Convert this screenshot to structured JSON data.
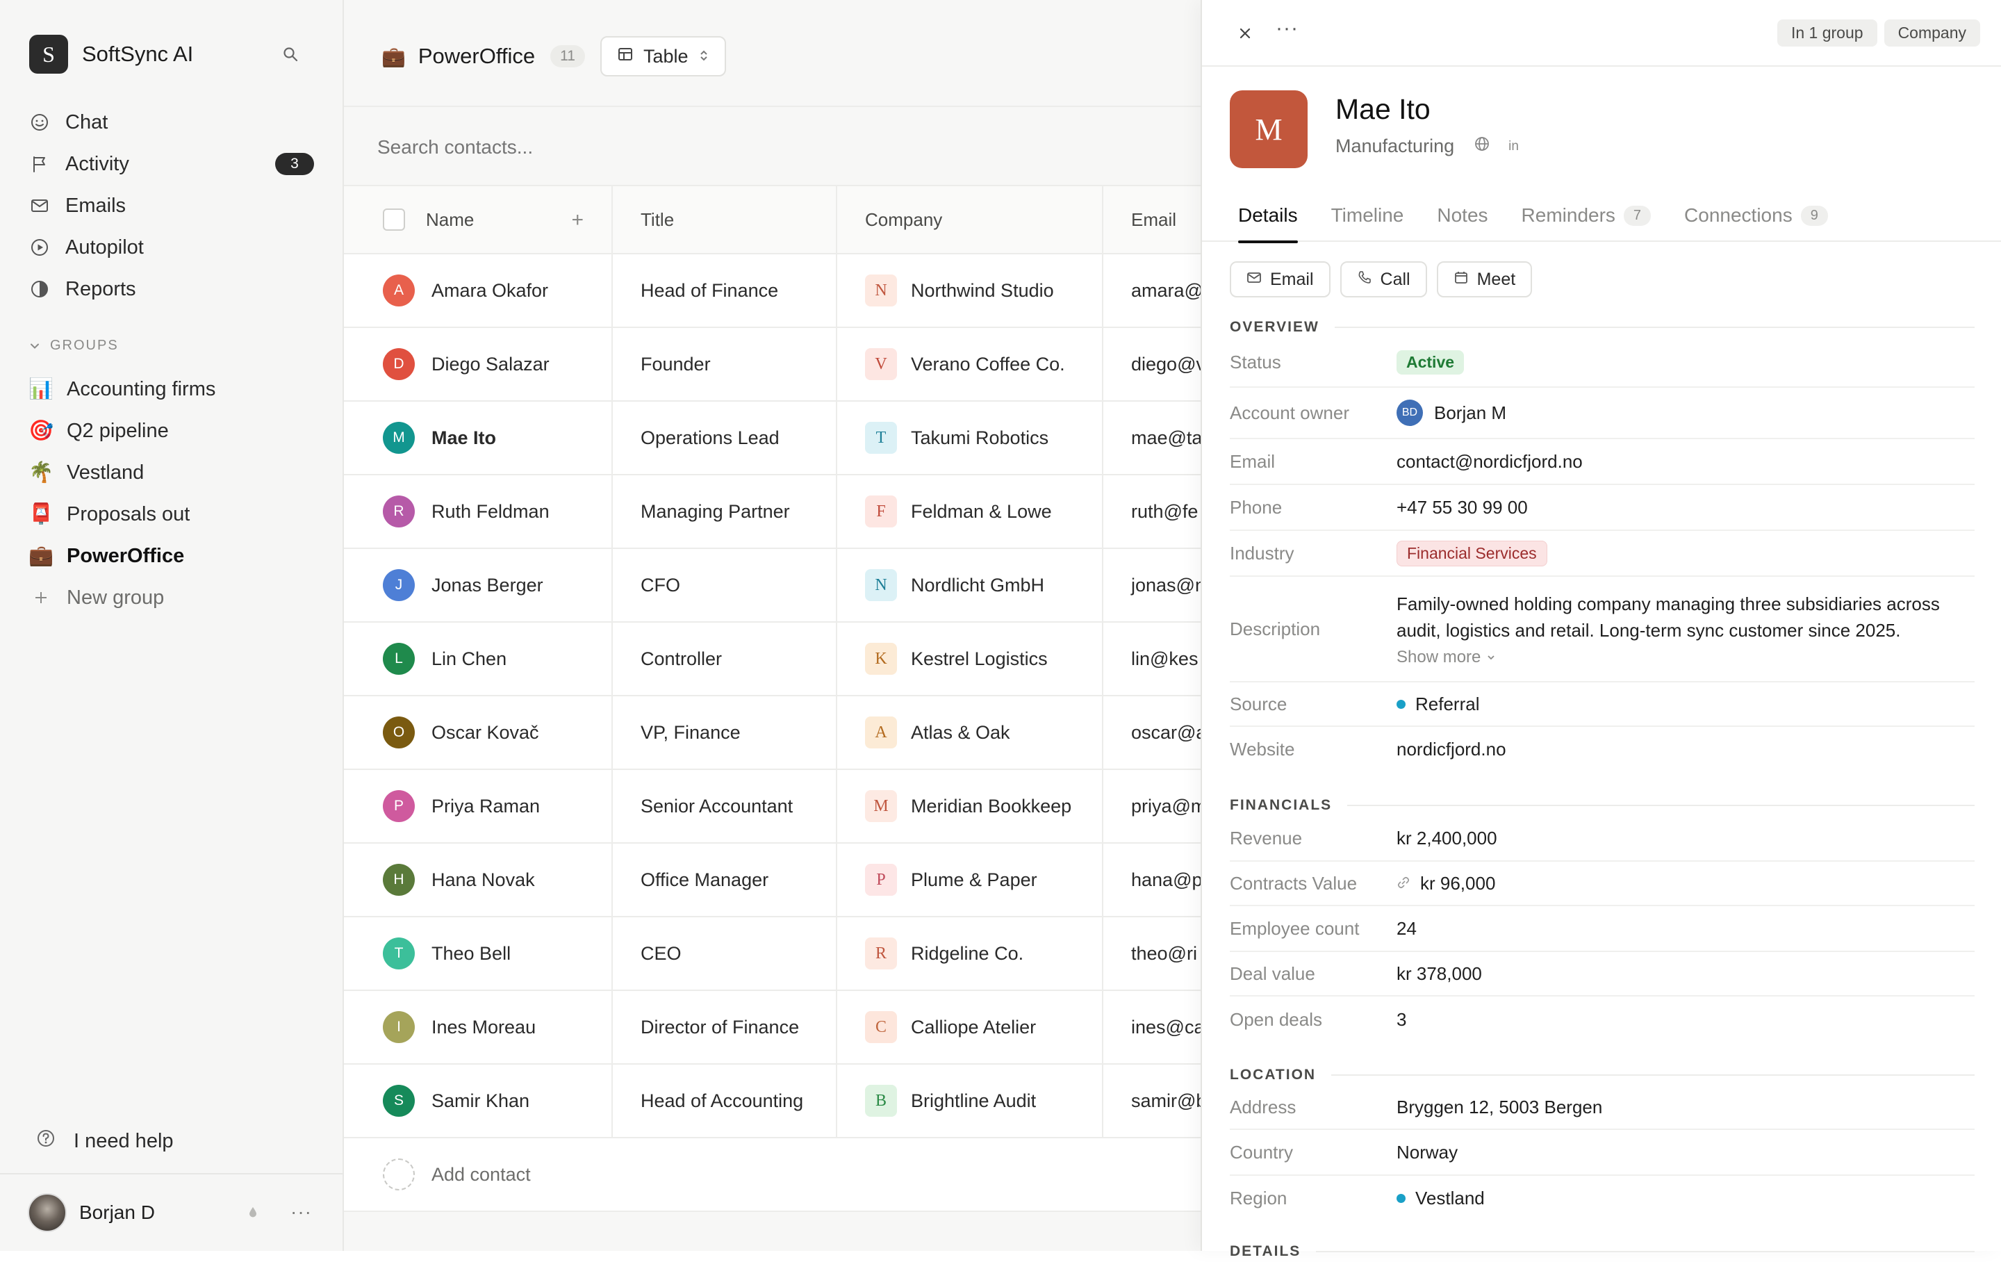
{
  "app": {
    "name": "SoftSync AI",
    "logo_letter": "S"
  },
  "nav": [
    {
      "label": "Chat",
      "icon": "smile-icon"
    },
    {
      "label": "Activity",
      "icon": "flag-icon",
      "badge": "3"
    },
    {
      "label": "Emails",
      "icon": "mail-icon"
    },
    {
      "label": "Autopilot",
      "icon": "play-circle-icon"
    },
    {
      "label": "Reports",
      "icon": "pie-icon"
    }
  ],
  "groups": {
    "header": "GROUPS",
    "items": [
      {
        "label": "Accounting firms",
        "emoji": "📊"
      },
      {
        "label": "Q2 pipeline",
        "emoji": "🎯"
      },
      {
        "label": "Vestland",
        "emoji": "🌴"
      },
      {
        "label": "Proposals out",
        "emoji": "📮"
      },
      {
        "label": "PowerOffice",
        "emoji": "💼"
      }
    ],
    "new_group": "New group"
  },
  "help": "I need help",
  "user": {
    "name": "Borjan D",
    "more": "···"
  },
  "main": {
    "title": "PowerOffice",
    "title_emoji": "💼",
    "count": "11",
    "view": "Table",
    "search_placeholder": "Search contacts...",
    "columns": {
      "name": "Name",
      "title": "Title",
      "company": "Company",
      "email": "Email"
    },
    "add_contact": "Add contact"
  },
  "contacts": [
    {
      "initial": "A",
      "name": "Amara Okafor",
      "title": "Head of Finance",
      "company": "Northwind Studio",
      "co_initial": "N",
      "email": "amara@",
      "av_color": "#e8604c",
      "co_bg": "#fde9e1",
      "co_fg": "#c0573f"
    },
    {
      "initial": "D",
      "name": "Diego Salazar",
      "title": "Founder",
      "company": "Verano Coffee Co.",
      "co_initial": "V",
      "email": "diego@v",
      "av_color": "#e0503f",
      "co_bg": "#fde6e2",
      "co_fg": "#c04b3b"
    },
    {
      "initial": "M",
      "name": "Mae Ito",
      "title": "Operations Lead",
      "company": "Takumi Robotics",
      "co_initial": "T",
      "email": "mae@ta",
      "av_color": "#12968f",
      "co_bg": "#dcf1f6",
      "co_fg": "#1d7f97",
      "selected": true
    },
    {
      "initial": "R",
      "name": "Ruth Feldman",
      "title": "Managing Partner",
      "company": "Feldman & Lowe",
      "co_initial": "F",
      "email": "ruth@fe",
      "av_color": "#b65aa8",
      "co_bg": "#fde6e2",
      "co_fg": "#c04b3b"
    },
    {
      "initial": "J",
      "name": "Jonas Berger",
      "title": "CFO",
      "company": "Nordlicht GmbH",
      "co_initial": "N",
      "email": "jonas@n",
      "av_color": "#4e7fd6",
      "co_bg": "#dcf1f6",
      "co_fg": "#1d7f97"
    },
    {
      "initial": "L",
      "name": "Lin Chen",
      "title": "Controller",
      "company": "Kestrel Logistics",
      "co_initial": "K",
      "email": "lin@kes",
      "av_color": "#1f8a4c",
      "co_bg": "#fcebd6",
      "co_fg": "#b36b1f"
    },
    {
      "initial": "O",
      "name": "Oscar Kovač",
      "title": "VP, Finance",
      "company": "Atlas & Oak",
      "co_initial": "A",
      "email": "oscar@a",
      "av_color": "#7a5a10",
      "co_bg": "#fcebd6",
      "co_fg": "#b36b1f"
    },
    {
      "initial": "P",
      "name": "Priya Raman",
      "title": "Senior Accountant",
      "company": "Meridian Bookkeep",
      "co_initial": "M",
      "email": "priya@m",
      "av_color": "#cf5a9e",
      "co_bg": "#fdeae3",
      "co_fg": "#c0573f"
    },
    {
      "initial": "H",
      "name": "Hana Novak",
      "title": "Office Manager",
      "company": "Plume & Paper",
      "co_initial": "P",
      "email": "hana@p",
      "av_color": "#5a7a3a",
      "co_bg": "#fde6e6",
      "co_fg": "#c04b5b"
    },
    {
      "initial": "T",
      "name": "Theo Bell",
      "title": "CEO",
      "company": "Ridgeline Co.",
      "co_initial": "R",
      "email": "theo@ri",
      "av_color": "#3cbf9a",
      "co_bg": "#fde9e1",
      "co_fg": "#c0573f"
    },
    {
      "initial": "I",
      "name": "Ines Moreau",
      "title": "Director of Finance",
      "company": "Calliope Atelier",
      "co_initial": "C",
      "email": "ines@ca",
      "av_color": "#a5a45a",
      "co_bg": "#fde6dc",
      "co_fg": "#c0673f"
    },
    {
      "initial": "S",
      "name": "Samir Khan",
      "title": "Head of Accounting",
      "company": "Brightline Audit",
      "co_initial": "B",
      "email": "samir@b",
      "av_color": "#168a5a",
      "co_bg": "#dff3e2",
      "co_fg": "#2a8a45"
    }
  ],
  "panel": {
    "chips": [
      "In 1 group",
      "Company"
    ],
    "logo_letter": "M",
    "name": "Mae Ito",
    "subtitle": "Manufacturing",
    "linkedin": "in",
    "tabs": [
      {
        "label": "Details"
      },
      {
        "label": "Timeline"
      },
      {
        "label": "Notes"
      },
      {
        "label": "Reminders",
        "count": "7"
      },
      {
        "label": "Connections",
        "count": "9"
      }
    ],
    "actions": [
      {
        "label": "Email",
        "icon": "mail-icon"
      },
      {
        "label": "Call",
        "icon": "phone-icon"
      },
      {
        "label": "Meet",
        "icon": "calendar-icon"
      }
    ],
    "overview": {
      "header": "OVERVIEW",
      "status_label": "Status",
      "status": "Active",
      "owner_label": "Account owner",
      "owner_initials": "BD",
      "owner": "Borjan M",
      "email_label": "Email",
      "email": "contact@nordicfjord.no",
      "phone_label": "Phone",
      "phone": "+47 55 30 99 00",
      "industry_label": "Industry",
      "industry": "Financial Services",
      "description_label": "Description",
      "description_1": "Family-owned holding company managing three subsidiaries across",
      "description_2": "audit, logistics and retail. Long-term sync customer since 2025.",
      "show_more": "Show more",
      "source_label": "Source",
      "source": "Referral",
      "website_label": "Website",
      "website": "nordicfjord.no"
    },
    "financials": {
      "header": "FINANCIALS",
      "revenue_label": "Revenue",
      "revenue": "kr 2,400,000",
      "contracts_label": "Contracts Value",
      "contracts": "kr 96,000",
      "employees_label": "Employee count",
      "employees": "24",
      "deal_label": "Deal value",
      "deal": "kr 378,000",
      "open_label": "Open deals",
      "open": "3"
    },
    "location": {
      "header": "LOCATION",
      "address_label": "Address",
      "address": "Bryggen 12, 5003 Bergen",
      "country_label": "Country",
      "country": "Norway",
      "region_label": "Region",
      "region": "Vestland"
    },
    "next_header": "DETAILS"
  }
}
